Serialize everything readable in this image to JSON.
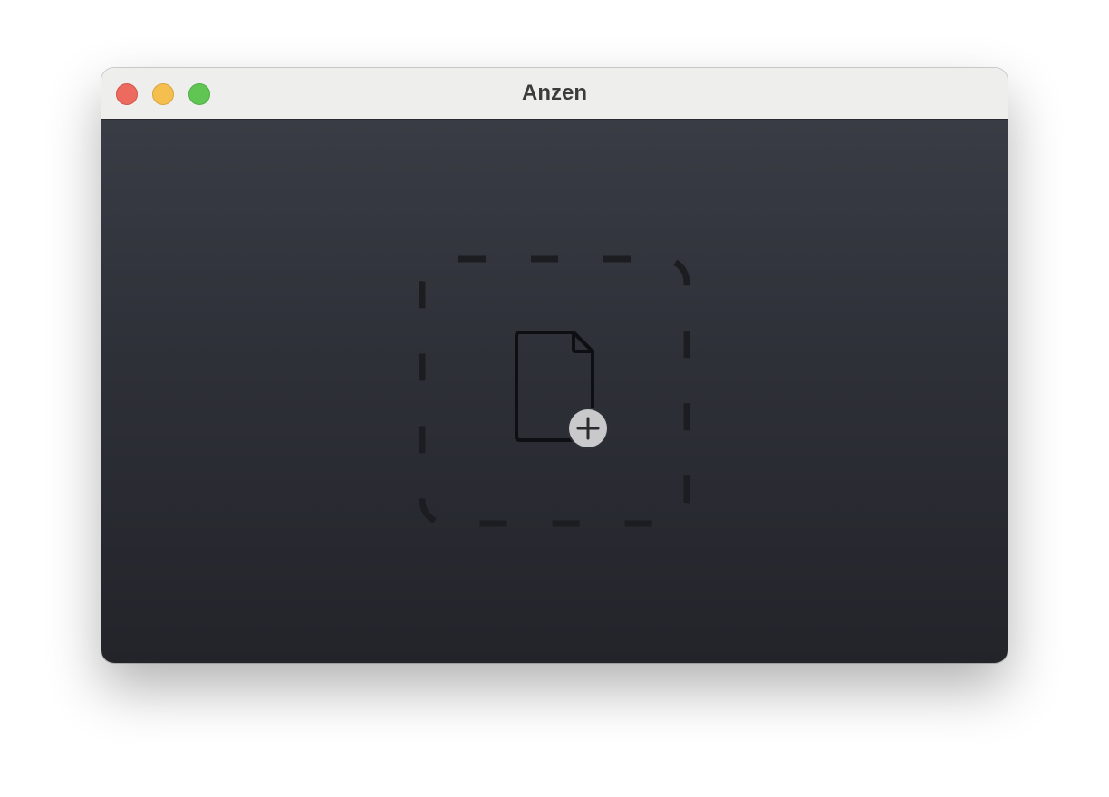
{
  "window": {
    "title": "Anzen"
  },
  "traffic_lights": {
    "close_color": "#ec6a5e",
    "minimize_color": "#f4bf4f",
    "zoom_color": "#61c554"
  },
  "drop_zone": {
    "icon": "file-add-icon",
    "badge_icon": "plus-circle-icon"
  }
}
